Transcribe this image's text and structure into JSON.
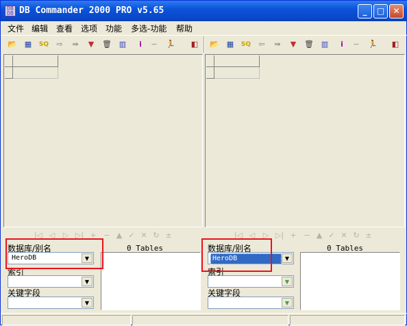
{
  "window": {
    "title": "DB Commander 2000 PRO v5.65",
    "app_icon": "db-icon"
  },
  "title_buttons": {
    "minimize": "_",
    "maximize": "□",
    "close": "✕"
  },
  "menu": [
    "文件",
    "编辑",
    "查看",
    "选项",
    "功能",
    "多选-功能",
    "帮助"
  ],
  "toolbar_glyphs": {
    "open": "📂",
    "table": "▦",
    "sql": "SQ",
    "export": "⇨",
    "copy": "⇛",
    "filter": "▼",
    "delete": "🗑",
    "data": "▥",
    "index": "i",
    "link": "∽",
    "run": "🏃",
    "exit": "◧",
    "import": "⇦"
  },
  "nav_glyphs": [
    "|◁",
    "◁",
    "▷",
    "▷|",
    "+",
    "−",
    "▲",
    "✓",
    "✕",
    "↻",
    "±"
  ],
  "left_pane": {
    "database_label": "数据库/别名",
    "database_value": "HeroDB",
    "index_label": "索引",
    "index_value": "",
    "key_field_label": "关键字段",
    "key_field_value": "",
    "tables_count": "0 Tables"
  },
  "right_pane": {
    "database_label": "数据库/别名",
    "database_value": "HeroDB",
    "index_label": "索引",
    "index_value": "",
    "key_field_label": "关键字段",
    "key_field_value": "",
    "tables_count": "0 Tables"
  },
  "colors": {
    "title_bar": "#0b53d9",
    "highlight_box": "#e8121b",
    "selection": "#316ac5"
  }
}
